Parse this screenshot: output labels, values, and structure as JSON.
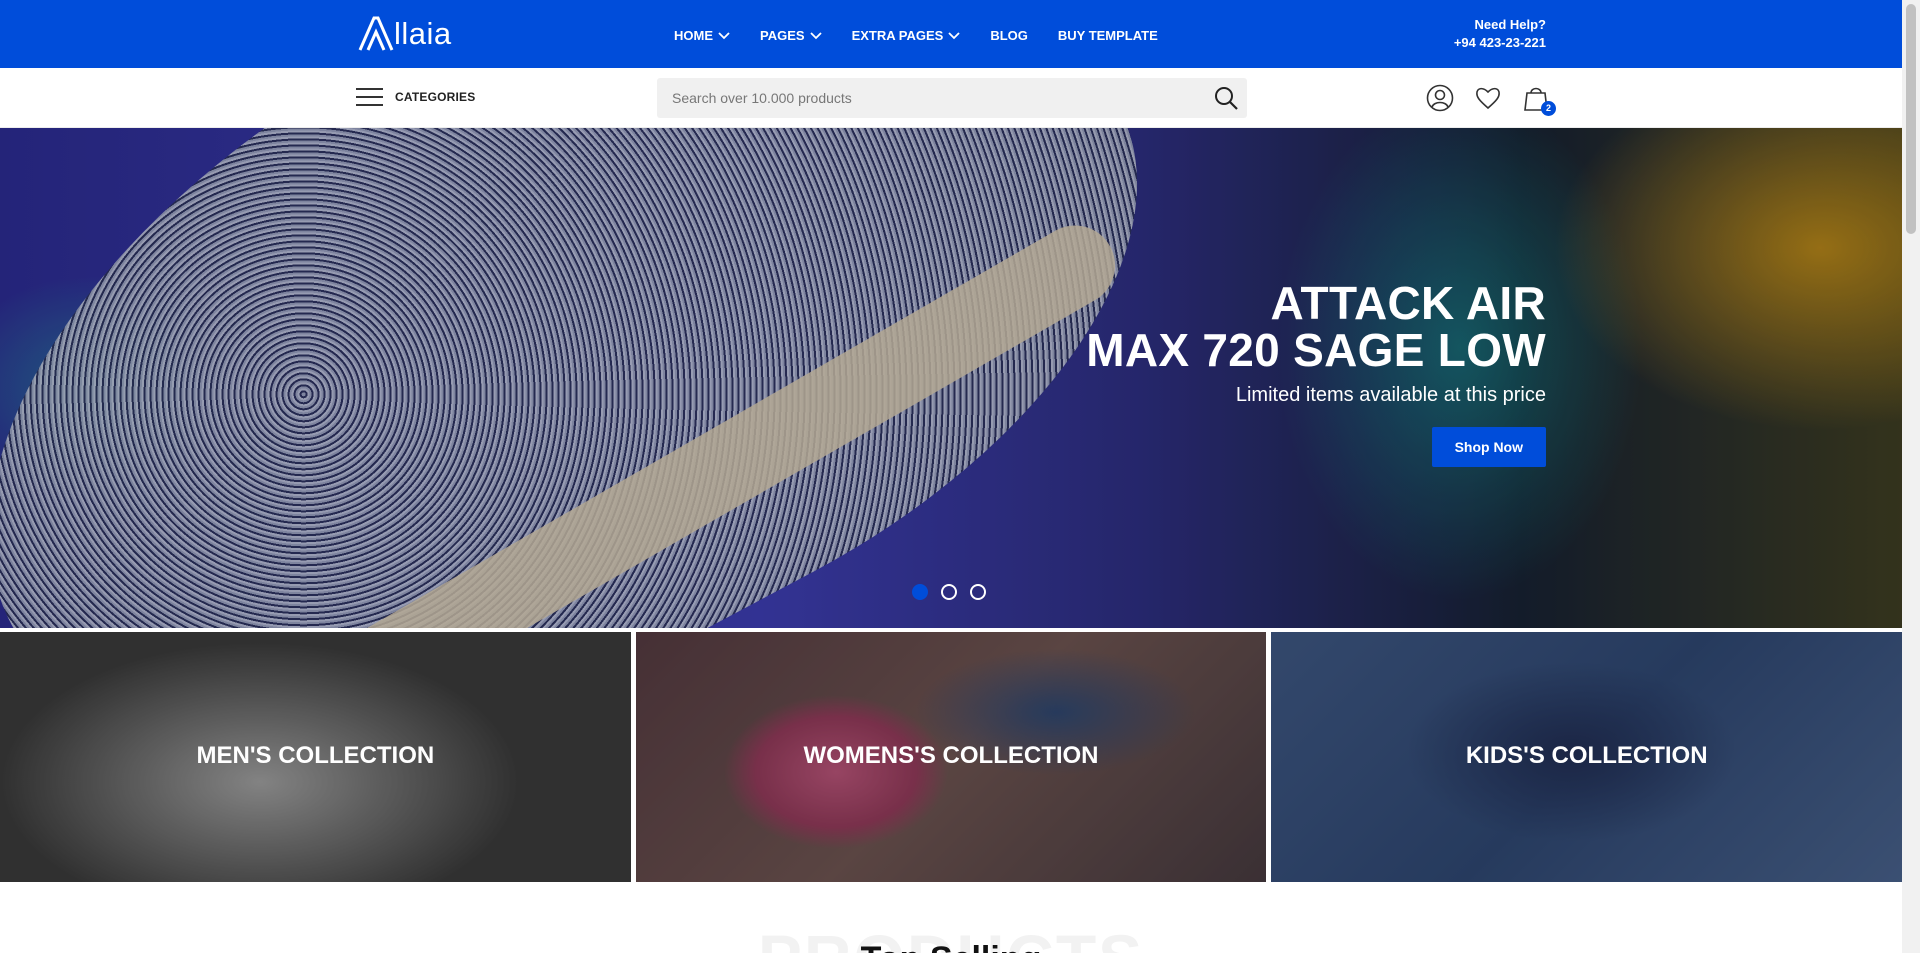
{
  "brand": {
    "name": "llaia"
  },
  "nav": {
    "items": [
      {
        "label": "HOME",
        "dropdown": true
      },
      {
        "label": "PAGES",
        "dropdown": true
      },
      {
        "label": "EXTRA PAGES",
        "dropdown": true
      },
      {
        "label": "BLOG",
        "dropdown": false
      },
      {
        "label": "BUY TEMPLATE",
        "dropdown": false
      }
    ]
  },
  "help": {
    "label": "Need Help?",
    "phone": "+94 423-23-221"
  },
  "categories": {
    "label": "CATEGORIES"
  },
  "search": {
    "placeholder": "Search over 10.000 products"
  },
  "cart": {
    "count": "2"
  },
  "hero": {
    "title_line1": "ATTACK AIR",
    "title_line2": "MAX 720 SAGE LOW",
    "subtitle": "Limited items available at this price",
    "cta": "Shop Now",
    "slides": 3,
    "active_slide": 1
  },
  "collections": [
    {
      "title": "MEN'S COLLECTION"
    },
    {
      "title": "WOMENS'S COLLECTION"
    },
    {
      "title": "KIDS'S COLLECTION"
    }
  ],
  "products": {
    "bg_label": "PRODUCTS",
    "title": "Top Selling"
  },
  "colors": {
    "brand_blue": "#004dda"
  },
  "icons": [
    "logo-icon",
    "chevron-down-icon",
    "hamburger-icon",
    "search-icon",
    "user-icon",
    "heart-icon",
    "bag-icon"
  ]
}
